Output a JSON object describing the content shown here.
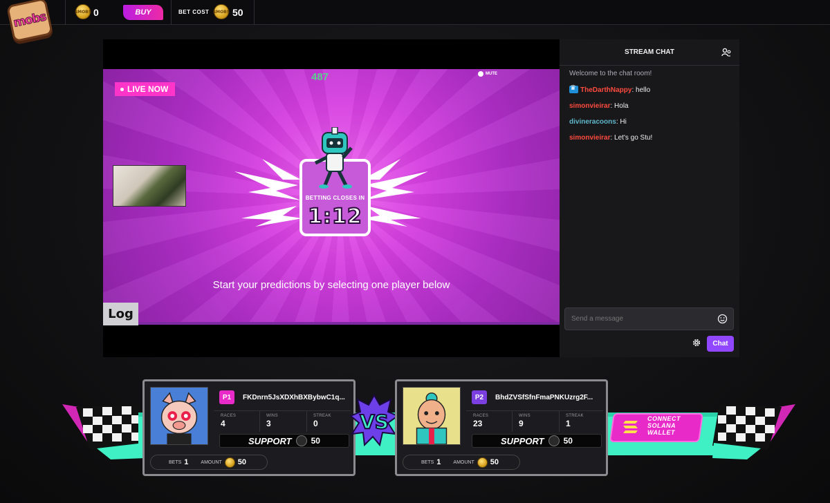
{
  "topbar": {
    "logo_text": "mobs",
    "coin_text": "$MOBS",
    "balance": "0",
    "buy_label": "BUY",
    "bet_cost_label": "BET COST",
    "bet_cost_value": "50"
  },
  "stream": {
    "live_label": "LIVE NOW",
    "viewer_count": "487",
    "mute_label": "MUTE",
    "betting_closes_label": "BETTING CLOSES IN",
    "timer": "1:12",
    "prompt": "Start your predictions by selecting one player below",
    "log_label": "Log"
  },
  "chat": {
    "title": "STREAM CHAT",
    "welcome": "Welcome to the chat room!",
    "messages": [
      {
        "user": "TheDarthNappy",
        "text": ": hello",
        "color": "#ff4a3d",
        "badge": true
      },
      {
        "user": "simonvieirar",
        "text": ": Hola",
        "color": "#ff4a3d",
        "badge": false
      },
      {
        "user": "divineracoons",
        "text": ": Hi",
        "color": "#5fb7c9",
        "badge": false
      },
      {
        "user": "simonvieirar",
        "text": ": Let's go Stu!",
        "color": "#ff4a3d",
        "badge": false
      }
    ],
    "input_placeholder": "Send a message",
    "send_label": "Chat"
  },
  "players": [
    {
      "tag": "P1",
      "tag_color": "#e72ac8",
      "address": "FKDnrn5JsXDXhBXBybwC1q...",
      "races_label": "RACES",
      "races": "4",
      "wins_label": "WINS",
      "wins": "3",
      "streak_label": "STREAK",
      "streak": "0",
      "support_label": "SUPPORT",
      "support_cost": "50",
      "bets_label": "BETS",
      "bets": "1",
      "amount_label": "AMOUNT",
      "amount": "50"
    },
    {
      "tag": "P2",
      "tag_color": "#7b3fe0",
      "address": "BhdZVSfSfnFmaPNKUzrg2F...",
      "races_label": "RACES",
      "races": "23",
      "wins_label": "WINS",
      "wins": "9",
      "streak_label": "STREAK",
      "streak": "1",
      "support_label": "SUPPORT",
      "support_cost": "50",
      "bets_label": "BETS",
      "bets": "1",
      "amount_label": "AMOUNT",
      "amount": "50"
    }
  ],
  "wallet": {
    "line1": "CONNECT",
    "line2": "SOLANA",
    "line3": "WALLET"
  },
  "colors": {
    "accent_pink": "#e72ac8",
    "accent_purple": "#9147ff",
    "banner_teal": "#3ff0c4"
  }
}
